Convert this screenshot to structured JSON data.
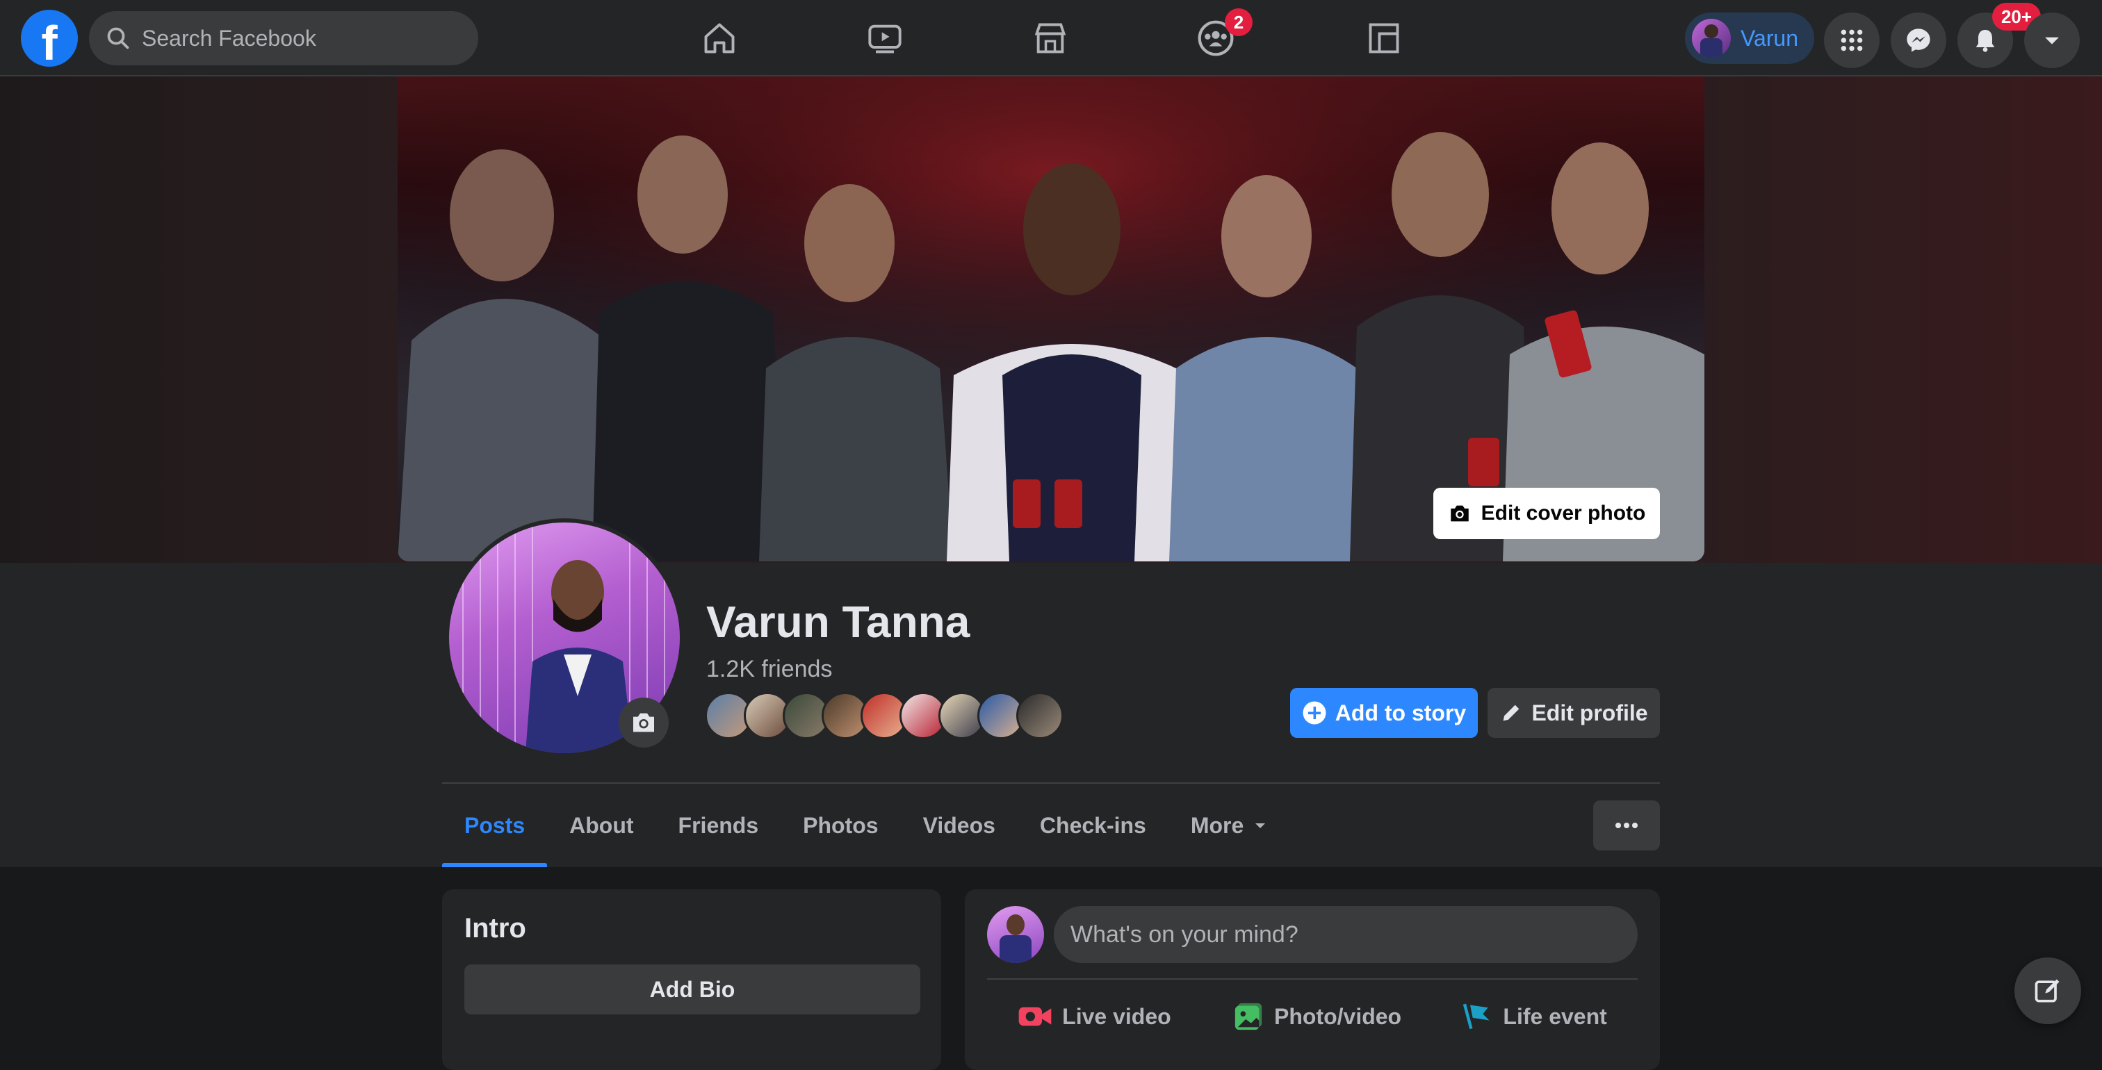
{
  "topbar": {
    "logo_letter": "f",
    "search_placeholder": "Search Facebook",
    "nav_icons": [
      "home-icon",
      "watch-icon",
      "marketplace-icon",
      "groups-icon",
      "gaming-icon"
    ],
    "groups_badge": "2",
    "profile_name": "Varun",
    "notifications_badge": "20+",
    "accent": "#2d88ff"
  },
  "cover": {
    "edit_label": "Edit cover photo"
  },
  "profile": {
    "name": "Varun Tanna",
    "friends": "1.2K friends",
    "add_story": "Add to story",
    "edit_profile": "Edit profile"
  },
  "tabs": {
    "posts": "Posts",
    "about": "About",
    "friends": "Friends",
    "photos": "Photos",
    "videos": "Videos",
    "checkins": "Check-ins",
    "more": "More"
  },
  "intro": {
    "title": "Intro",
    "add_bio": "Add Bio"
  },
  "composer": {
    "placeholder": "What's on your mind?",
    "live": "Live video",
    "photo": "Photo/video",
    "life": "Life event"
  }
}
